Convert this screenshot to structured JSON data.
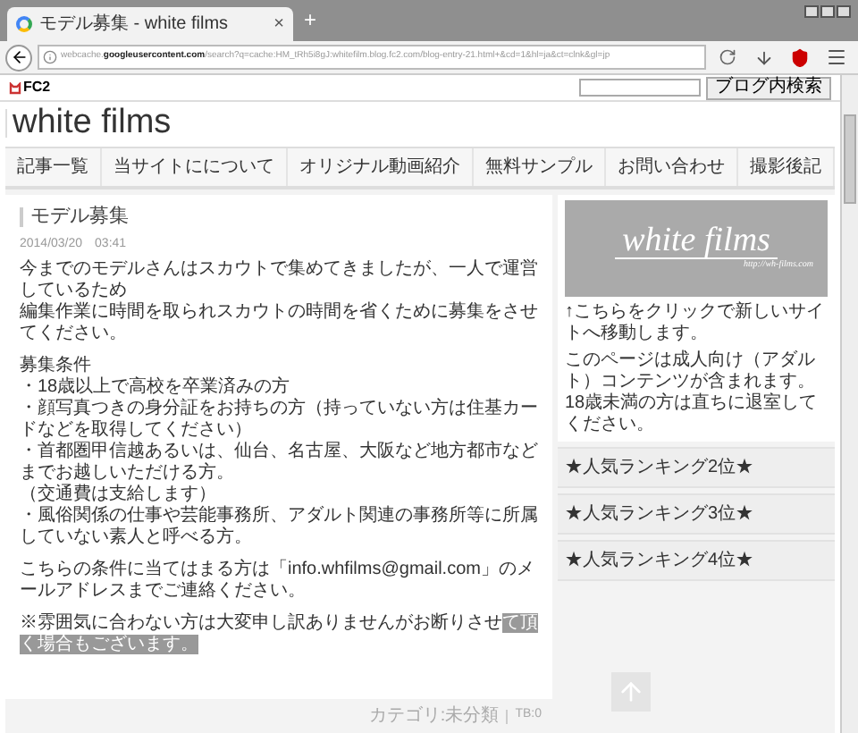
{
  "browser": {
    "tab_title": "モデル募集 - white films",
    "new_tab": "+",
    "tab_close": "×",
    "url_prefix": "webcache.",
    "url_domain": "googleusercontent.com",
    "url_rest": "/search?q=cache:HM_tRh5i8gJ:whitefilm.blog.fc2.com/blog-entry-21.html+&cd=1&hl=ja&ct=clnk&gl=jp"
  },
  "fc2_bar": {
    "logo": "FC2",
    "search_button": "ブログ内検索"
  },
  "blog_title": "white films",
  "nav": [
    {
      "label": "記事一覧"
    },
    {
      "label": "当サイトにについて"
    },
    {
      "label": "オリジナル動画紹介"
    },
    {
      "label": "無料サンプル"
    },
    {
      "label": "お問い合わせ"
    },
    {
      "label": "撮影後記"
    }
  ],
  "post": {
    "title": "モデル募集",
    "date": "2014/03/20　03:41",
    "paragraphs": [
      {
        "kind": "text",
        "lines": [
          "今までのモデルさんはスカウトで集めてきましたが、一人で運営しているため",
          "編集作業に時間を取られスカウトの時間を省くために募集をさせてください。"
        ]
      },
      {
        "kind": "text",
        "lines": [
          "募集条件",
          "・18歳以上で高校を卒業済みの方",
          "・顔写真つきの身分証をお持ちの方（持っていない方は住基カードなどを取得してください）",
          "・首都圏甲信越あるいは、仙台、名古屋、大阪など地方都市などまでお越しいただける方。",
          "（交通費は支給します）",
          "・風俗関係の仕事や芸能事務所、アダルト関連の事務所等に所属していない素人と呼べる方。"
        ]
      },
      {
        "kind": "text",
        "lines": [
          "こちらの条件に当てはまる方は「info.whfilms@gmail.com」のメールアドレスまでご連絡ください。"
        ]
      },
      {
        "kind": "selection",
        "text": "※雰囲気に合わない方は大変申し訳ありませんがお断りさせ",
        "selected_text": "て頂く場合もございます。"
      }
    ],
    "category": "カテゴリ:未分類",
    "trackbacks": "TB:0"
  },
  "sidebar": {
    "banner_title": "white films",
    "banner_url": "http://wh-films.com",
    "notes": [
      "↑こちらをクリックで新しいサイトへ移動します。",
      "このページは成人向け（アダルト）コンテンツが含まれます。18歳未満の方は直ちに退室してください。"
    ],
    "rankings": [
      "★人気ランキング2位★",
      "★人気ランキング3位★",
      "★人気ランキング4位★"
    ]
  }
}
